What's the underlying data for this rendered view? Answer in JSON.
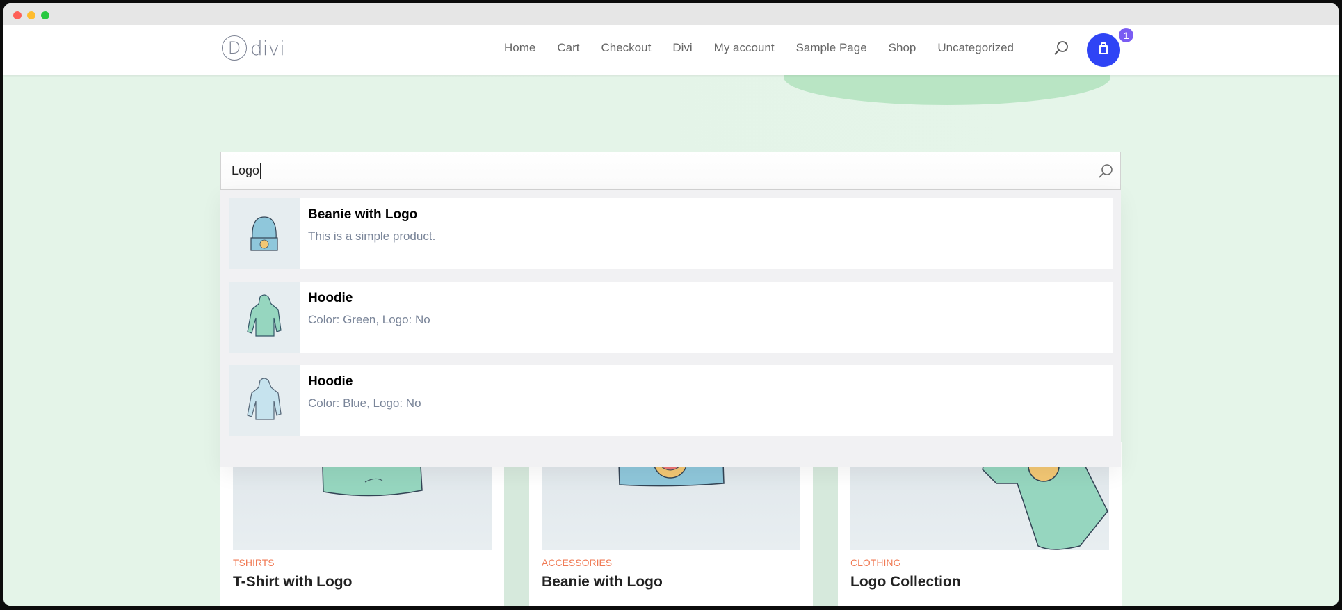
{
  "window": {
    "traffic_lights": [
      "close",
      "minimize",
      "maximize"
    ]
  },
  "header": {
    "logo": {
      "mark": "D",
      "text": "divi"
    },
    "nav": [
      {
        "label": "Home"
      },
      {
        "label": "Cart"
      },
      {
        "label": "Checkout"
      },
      {
        "label": "Divi"
      },
      {
        "label": "My account"
      },
      {
        "label": "Sample Page"
      },
      {
        "label": "Shop"
      },
      {
        "label": "Uncategorized"
      }
    ],
    "search_icon": "search-icon",
    "cart": {
      "icon": "shopping-bag-icon",
      "count": "1"
    }
  },
  "search": {
    "value": "Logo",
    "submit_icon": "search-icon"
  },
  "results": [
    {
      "title": "Beanie with Logo",
      "description": "This is a simple product.",
      "thumb": "beanie"
    },
    {
      "title": "Hoodie",
      "description": "Color: Green, Logo: No",
      "thumb": "hoodie-green"
    },
    {
      "title": "Hoodie",
      "description": "Color: Blue, Logo: No",
      "thumb": "hoodie-blue"
    }
  ],
  "products": [
    {
      "category": "TSHIRTS",
      "title": "T-Shirt with Logo"
    },
    {
      "category": "ACCESSORIES",
      "title": "Beanie with Logo"
    },
    {
      "category": "CLOTHING",
      "title": "Logo Collection"
    }
  ],
  "colors": {
    "accent_blue": "#2f44f5",
    "badge_purple": "#7a5cf3",
    "category_orange": "#f07a54",
    "page_green": "#e4f4e8"
  }
}
